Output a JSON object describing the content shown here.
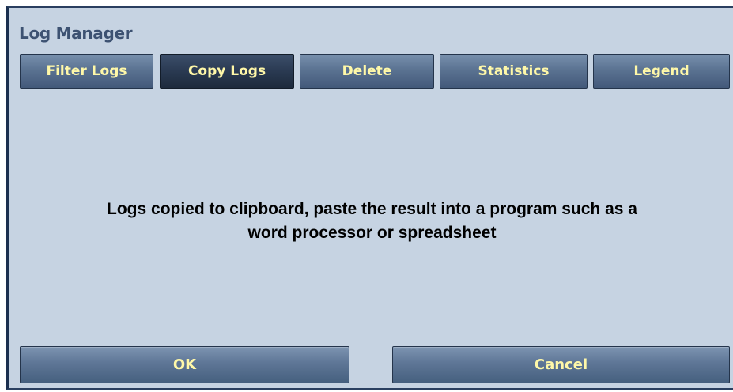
{
  "window": {
    "title": "Log Manager"
  },
  "tabs": [
    {
      "label": "Filter Logs",
      "active": false
    },
    {
      "label": "Copy Logs",
      "active": true
    },
    {
      "label": "Delete",
      "active": false
    },
    {
      "label": "Statistics",
      "active": false
    },
    {
      "label": "Legend",
      "active": false
    }
  ],
  "message": {
    "line1": "Logs copied to clipboard, paste the result into a program such as a",
    "line2": "word processor or spreadsheet"
  },
  "buttons": {
    "ok_label": "OK",
    "cancel_label": "Cancel"
  },
  "colors": {
    "panel_background": "#c6d3e2",
    "button_text": "#fff8a8",
    "active_tab": "#2a3a52",
    "title_text": "#3d5272"
  }
}
